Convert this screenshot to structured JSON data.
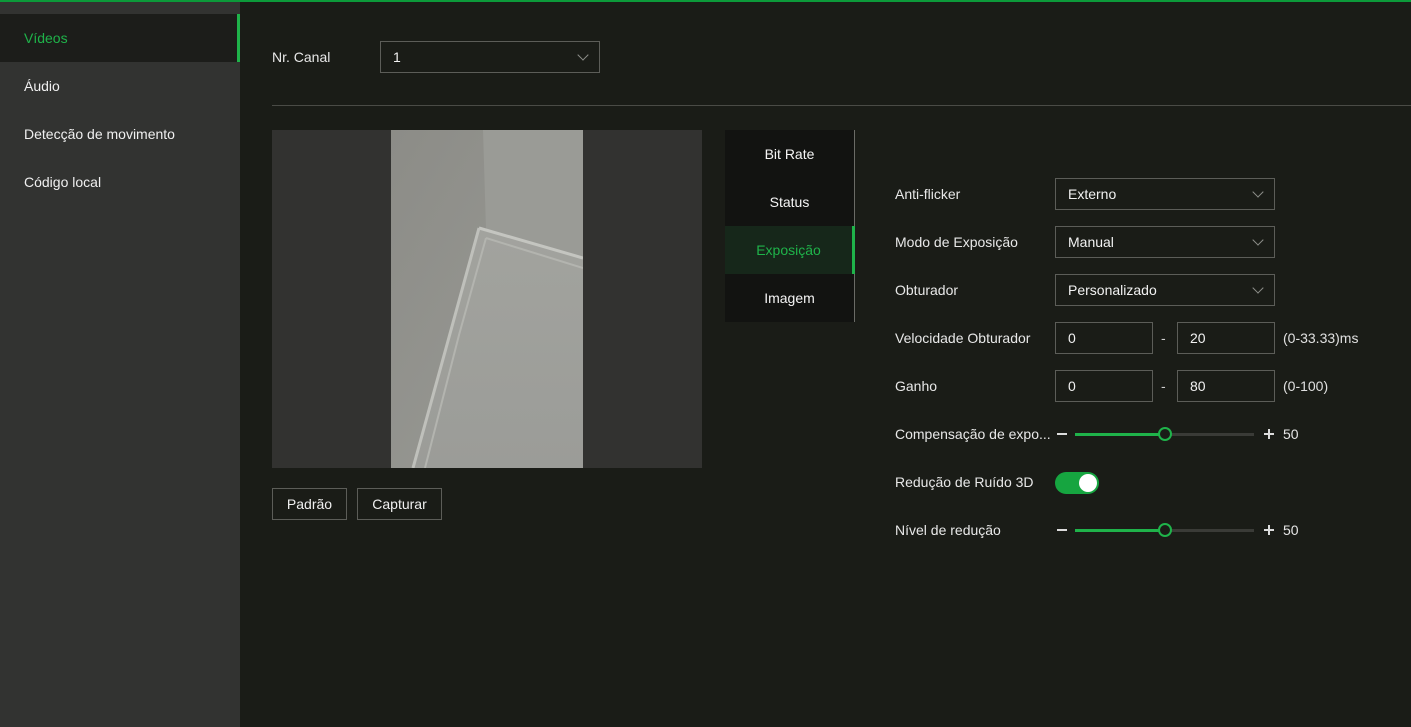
{
  "sidebar": {
    "items": [
      {
        "label": "Vídeos",
        "active": true
      },
      {
        "label": "Áudio"
      },
      {
        "label": "Detecção de movimento"
      },
      {
        "label": "Código local"
      }
    ]
  },
  "channel": {
    "label": "Nr. Canal",
    "value": "1"
  },
  "preview": {
    "default_button": "Padrão",
    "capture_button": "Capturar"
  },
  "tabs": [
    {
      "label": "Bit Rate"
    },
    {
      "label": "Status"
    },
    {
      "label": "Exposição",
      "active": true
    },
    {
      "label": "Imagem"
    }
  ],
  "exposure": {
    "anti_flicker": {
      "label": "Anti-flicker",
      "value": "Externo"
    },
    "mode": {
      "label": "Modo de Exposição",
      "value": "Manual"
    },
    "shutter": {
      "label": "Obturador",
      "value": "Personalizado"
    },
    "shutter_speed": {
      "label": "Velocidade Obturador",
      "min": "0",
      "max": "20",
      "range_hint": "(0-33.33)ms"
    },
    "gain": {
      "label": "Ganho",
      "min": "0",
      "max": "80",
      "range_hint": "(0-100)"
    },
    "compensation": {
      "label": "Compensação de expo...",
      "value": "50",
      "level": 0.5
    },
    "noise_reduction_3d": {
      "label": "Redução de Ruído 3D",
      "enabled": true
    },
    "reduction_level": {
      "label": "Nível de redução",
      "value": "50",
      "level": 0.5
    }
  },
  "colors": {
    "accent": "#1fb34a",
    "background": "#1a1c17",
    "sidebar": "#323331"
  }
}
